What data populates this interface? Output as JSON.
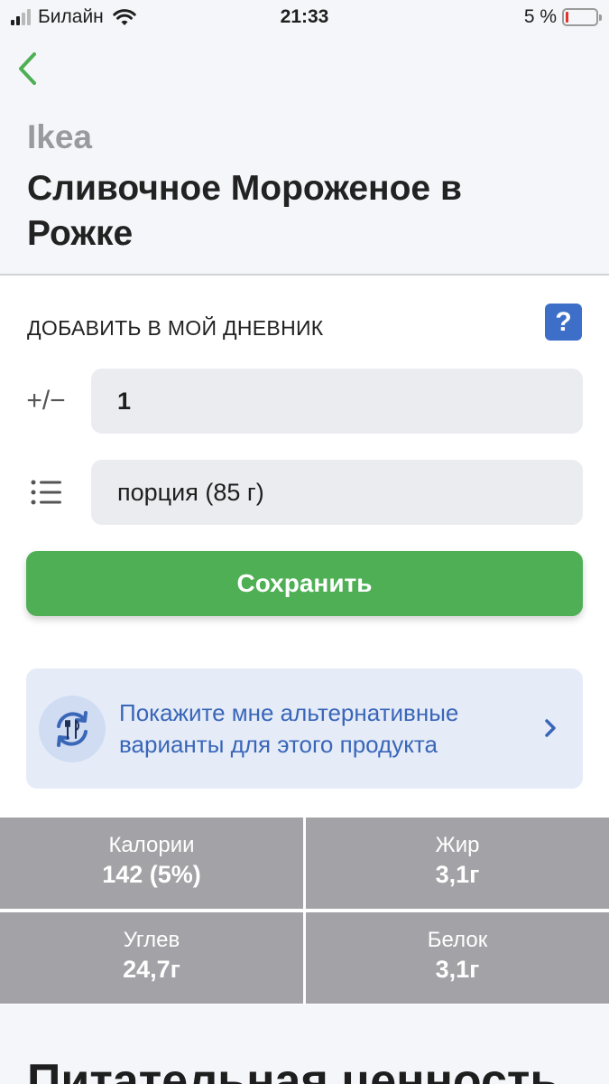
{
  "status_bar": {
    "carrier": "Билайн",
    "time": "21:33",
    "battery_percent": "5 %",
    "signal_bars_active": 2,
    "signal_bars_total": 4,
    "battery_level": 0.05,
    "battery_color": "#e0352b"
  },
  "header": {
    "back_icon": "chevron-left-icon",
    "brand": "Ikea",
    "title": "Сливочное Мороженое в Рожке"
  },
  "diary": {
    "section_label": "ДОБАВИТЬ В МОЙ ДНЕВНИК",
    "help_label": "?",
    "quantity_icon_text": "+/−",
    "quantity_value": "1",
    "serving_icon": "list-icon",
    "serving_value": "порция (85 г)",
    "save_label": "Сохранить"
  },
  "alternatives": {
    "icon": "swap-cutlery-icon",
    "text": "Покажите мне альтернативные варианты для этого продукта",
    "chevron_icon": "chevron-right-icon"
  },
  "nutrients": [
    {
      "label": "Калории",
      "value": "142 (5%)"
    },
    {
      "label": "Жир",
      "value": "3,1г"
    },
    {
      "label": "Углев",
      "value": "24,7г"
    },
    {
      "label": "Белок",
      "value": "3,1г"
    }
  ],
  "nutrition_section": {
    "title": "Питательная ценность"
  },
  "colors": {
    "accent_green": "#4faf55",
    "accent_blue": "#3d6fc9",
    "link_blue": "#3a66b8",
    "tile_gray": "#a3a3a7"
  }
}
